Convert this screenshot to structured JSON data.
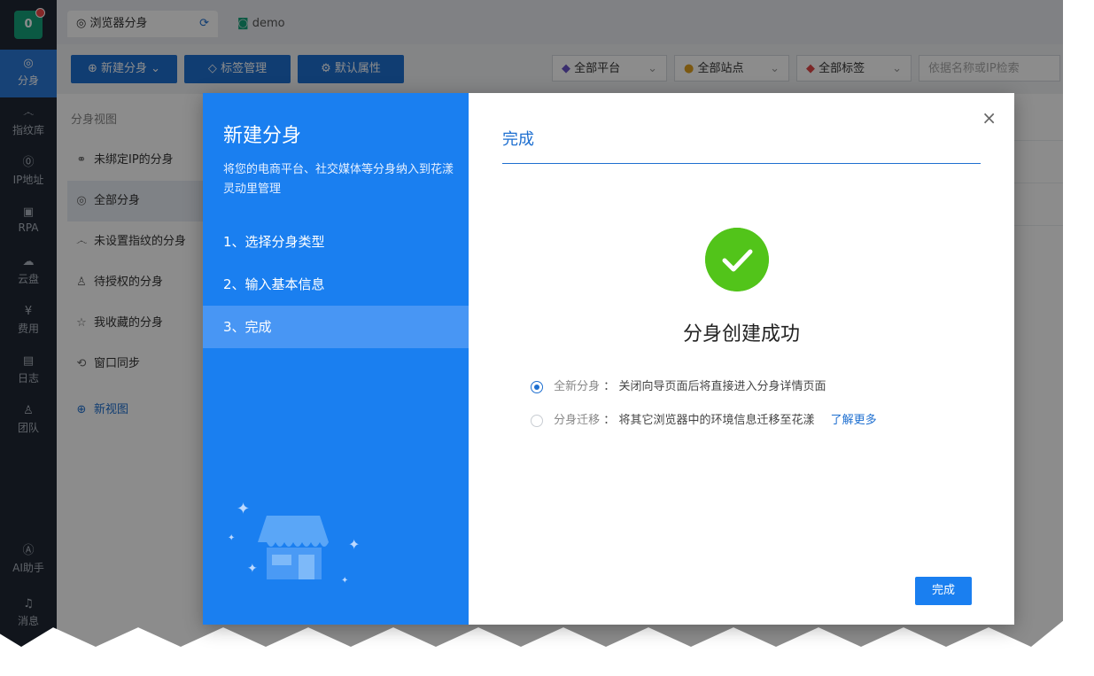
{
  "logo": {
    "text": "0"
  },
  "nav": {
    "items": [
      {
        "label": "分身",
        "icon": "chrome-icon"
      },
      {
        "label": "指纹库",
        "icon": "fingerprint-icon"
      },
      {
        "label": "IP地址",
        "icon": "ip-icon"
      },
      {
        "label": "RPA",
        "icon": "robot-icon"
      },
      {
        "label": "云盘",
        "icon": "cloud-icon"
      },
      {
        "label": "费用",
        "icon": "yen-icon"
      },
      {
        "label": "日志",
        "icon": "document-icon"
      },
      {
        "label": "团队",
        "icon": "team-icon"
      },
      {
        "label": "AI助手",
        "icon": "ai-icon"
      },
      {
        "label": "消息",
        "icon": "bell-icon"
      }
    ]
  },
  "tabs": [
    {
      "label": "浏览器分身"
    },
    {
      "label": "demo"
    }
  ],
  "toolbar": {
    "new_label": "新建分身",
    "tags_label": "标签管理",
    "defaults_label": "默认属性",
    "platform_filter": "全部平台",
    "site_filter": "全部站点",
    "tag_filter": "全部标签",
    "search_placeholder": "依据名称或IP检索"
  },
  "sidebar": {
    "title": "分身视图",
    "items": [
      {
        "label": "未绑定IP的分身"
      },
      {
        "label": "全部分身"
      },
      {
        "label": "未设置指纹的分身"
      },
      {
        "label": "待授权的分身"
      },
      {
        "label": "我收藏的分身"
      },
      {
        "label": "窗口同步"
      }
    ],
    "new_view": "新视图"
  },
  "modal": {
    "title": "新建分身",
    "desc": "将您的电商平台、社交媒体等分身纳入到花漾灵动里管理",
    "steps": [
      {
        "label": "1、选择分身类型"
      },
      {
        "label": "2、输入基本信息"
      },
      {
        "label": "3、完成"
      }
    ],
    "right_title": "完成",
    "success": "分身创建成功",
    "option1": {
      "name": "全新分身",
      "sep": "：",
      "desc": "关闭向导页面后将直接进入分身详情页面"
    },
    "option2": {
      "name": "分身迁移",
      "sep": "：",
      "desc": "将其它浏览器中的环境信息迁移至花漾",
      "link": "了解更多"
    },
    "done_button": "完成",
    "close_symbol": "×"
  }
}
